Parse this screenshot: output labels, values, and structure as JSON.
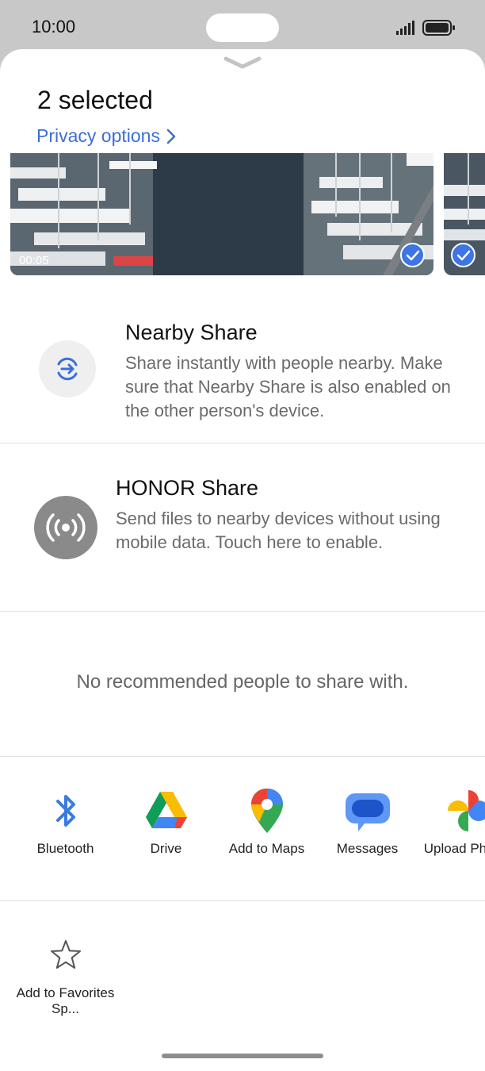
{
  "status": {
    "time": "10:00"
  },
  "sheet": {
    "title": "2 selected",
    "privacy_link": "Privacy options",
    "video_duration": "00:05"
  },
  "nearby": {
    "title": "Nearby Share",
    "description": "Share instantly with people nearby. Make sure that Nearby Share is also enabled on the other person's device."
  },
  "honor": {
    "title": "HONOR Share",
    "description": "Send files to nearby devices without using mobile data. Touch here to enable."
  },
  "people": {
    "empty_message": "No recommended people to share with."
  },
  "apps": [
    {
      "label": "Bluetooth",
      "icon": "bluetooth-icon"
    },
    {
      "label": "Drive",
      "icon": "google-drive-icon"
    },
    {
      "label": "Add to Maps",
      "icon": "google-maps-icon"
    },
    {
      "label": "Messages",
      "icon": "messages-icon"
    },
    {
      "label": "Upload Photos",
      "icon": "google-photos-icon"
    }
  ],
  "actions": [
    {
      "label": "Add to Favorites Sp...",
      "icon": "star-outline-icon"
    }
  ],
  "colors": {
    "accent": "#3b6fd8",
    "check": "#3d74e6",
    "honor_icon_bg": "#8a8a8a"
  }
}
